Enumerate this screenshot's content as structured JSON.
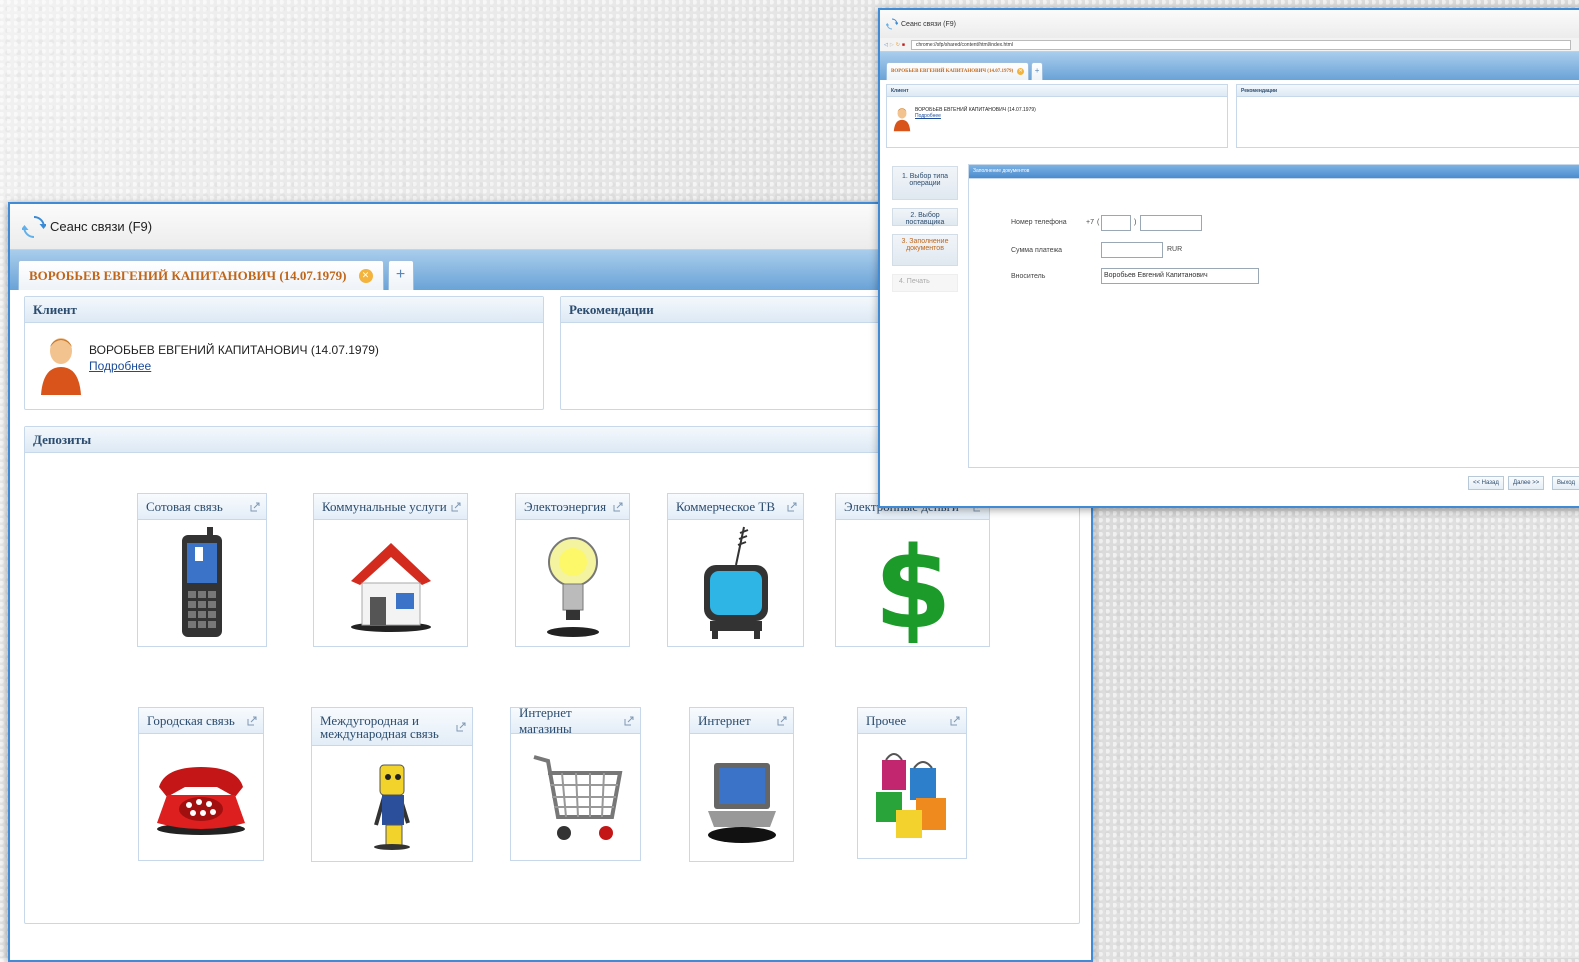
{
  "main_window": {
    "title": "Сеанс связи (F9)",
    "tab_label": "ВОРОБЬЕВ ЕВГЕНИЙ КАПИТАНОВИЧ  (14.07.1979)",
    "tab_add": "+",
    "client_panel": {
      "title": "Клиент",
      "client_name": "ВОРОБЬЕВ ЕВГЕНИЙ КАПИТАНОВИЧ (14.07.1979)",
      "details_link": "Подробнее"
    },
    "recommendations_panel": {
      "title": "Рекомендации"
    },
    "deposits_panel": {
      "title": "Депозиты",
      "tiles": [
        {
          "label": "Сотовая связь",
          "icon": "mobile-phone-icon"
        },
        {
          "label": "Коммунальные услуги",
          "icon": "house-icon"
        },
        {
          "label": "Электоэнергия",
          "icon": "light-bulb-icon"
        },
        {
          "label": "Коммерческое ТВ",
          "icon": "tv-icon"
        },
        {
          "label": "Электронные деньги",
          "icon": "dollar-sign-icon"
        },
        {
          "label": "Городская связь",
          "icon": "telephone-icon"
        },
        {
          "label": "Междугородная и международная связь",
          "icon": "mascot-phone-icon"
        },
        {
          "label": "Интернет магазины",
          "icon": "shopping-cart-icon"
        },
        {
          "label": "Интернет",
          "icon": "laptop-icon"
        },
        {
          "label": "Прочее",
          "icon": "shopping-bags-icon"
        }
      ]
    }
  },
  "popup_window": {
    "title": "Сеанс связи (F9)",
    "url": "chrome://sfp/shared/content/html/index.html",
    "tab_label": "ВОРОБЬЕВ ЕВГЕНИЙ КАПИТАНОВИЧ (14.07.1979)",
    "tab_add": "+",
    "client_panel": {
      "title": "Клиент",
      "client_name": "ВОРОБЬЕВ ЕВГЕНИЙ КАПИТАНОВИЧ (14.07.1979)",
      "details_link": "Подробнее"
    },
    "recommendations_panel": {
      "title": "Рекомендации"
    },
    "steps": [
      "1. Выбор типа операции",
      "2. Выбор поставщика",
      "3. Заполнение документов",
      "4. Печать"
    ],
    "form_panel_title": "Заполнение документов",
    "form": {
      "phone_label": "Номер телефона",
      "phone_prefix": "+7",
      "phone_paren": ")",
      "amount_label": "Сумма платежа",
      "currency": "RUR",
      "payer_label": "Вноситель",
      "payer_value": "Воробьев Евгений Капитанович"
    },
    "buttons": {
      "back": "<< Назад",
      "next": "Далее >>",
      "exit": "Выход"
    }
  }
}
